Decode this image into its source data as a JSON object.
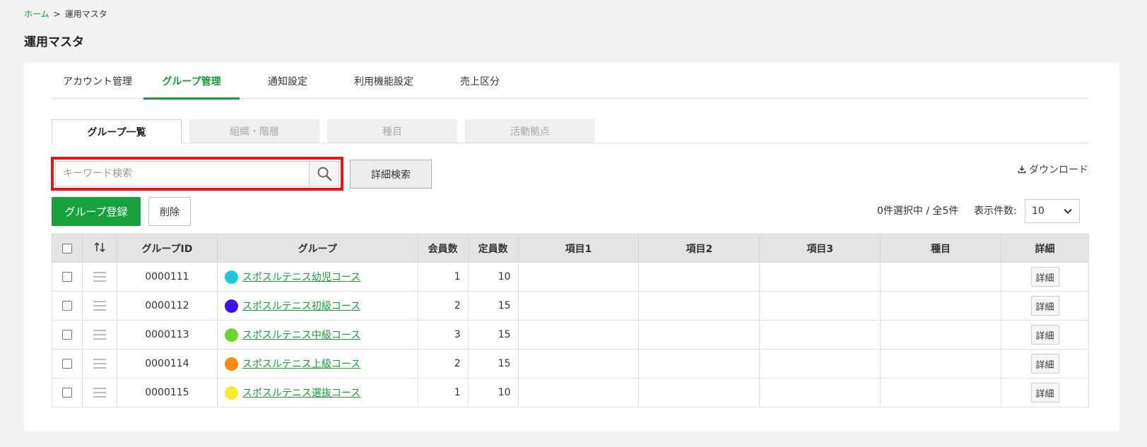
{
  "breadcrumb": {
    "home": "ホーム",
    "separator": ">",
    "current": "運用マスタ"
  },
  "page_title": "運用マスタ",
  "main_tabs": [
    {
      "label": "アカウント管理",
      "active": false
    },
    {
      "label": "グループ管理",
      "active": true
    },
    {
      "label": "通知設定",
      "active": false
    },
    {
      "label": "利用機能設定",
      "active": false
    },
    {
      "label": "売上区分",
      "active": false
    }
  ],
  "sub_tabs": [
    {
      "label": "グループ一覧",
      "active": true
    },
    {
      "label": "組織・階層",
      "active": false
    },
    {
      "label": "種目",
      "active": false
    },
    {
      "label": "活動拠点",
      "active": false
    }
  ],
  "search": {
    "placeholder": "キーワード検索",
    "value": ""
  },
  "buttons": {
    "detail_search": "詳細検索",
    "download": "ダウンロード",
    "register": "グループ登録",
    "delete": "削除"
  },
  "selection_info": "0件選択中 / 全5件",
  "per_page": {
    "label": "表示件数:",
    "value": "10"
  },
  "table": {
    "headers": {
      "group_id": "グループID",
      "group": "グループ",
      "members": "会員数",
      "capacity": "定員数",
      "item1": "項目1",
      "item2": "項目2",
      "item3": "項目3",
      "event": "種目",
      "detail": "詳細"
    },
    "rows": [
      {
        "id": "0000111",
        "name": "スポスルテニス幼児コース",
        "color": "#1ec8dc",
        "members": "1",
        "capacity": "10",
        "detail": "詳細"
      },
      {
        "id": "0000112",
        "name": "スポスルテニス初級コース",
        "color": "#3d12e6",
        "members": "2",
        "capacity": "15",
        "detail": "詳細"
      },
      {
        "id": "0000113",
        "name": "スポスルテニス中級コース",
        "color": "#6cd42a",
        "members": "3",
        "capacity": "15",
        "detail": "詳細"
      },
      {
        "id": "0000114",
        "name": "スポスルテニス上級コース",
        "color": "#fb8a0e",
        "members": "2",
        "capacity": "15",
        "detail": "詳細"
      },
      {
        "id": "0000115",
        "name": "スポスルテニス選抜コース",
        "color": "#fbe92c",
        "members": "1",
        "capacity": "10",
        "detail": "詳細"
      }
    ]
  },
  "colors": {
    "accent": "#1a9a3c",
    "highlight": "#e8141b",
    "register_button": "#17a13c"
  }
}
